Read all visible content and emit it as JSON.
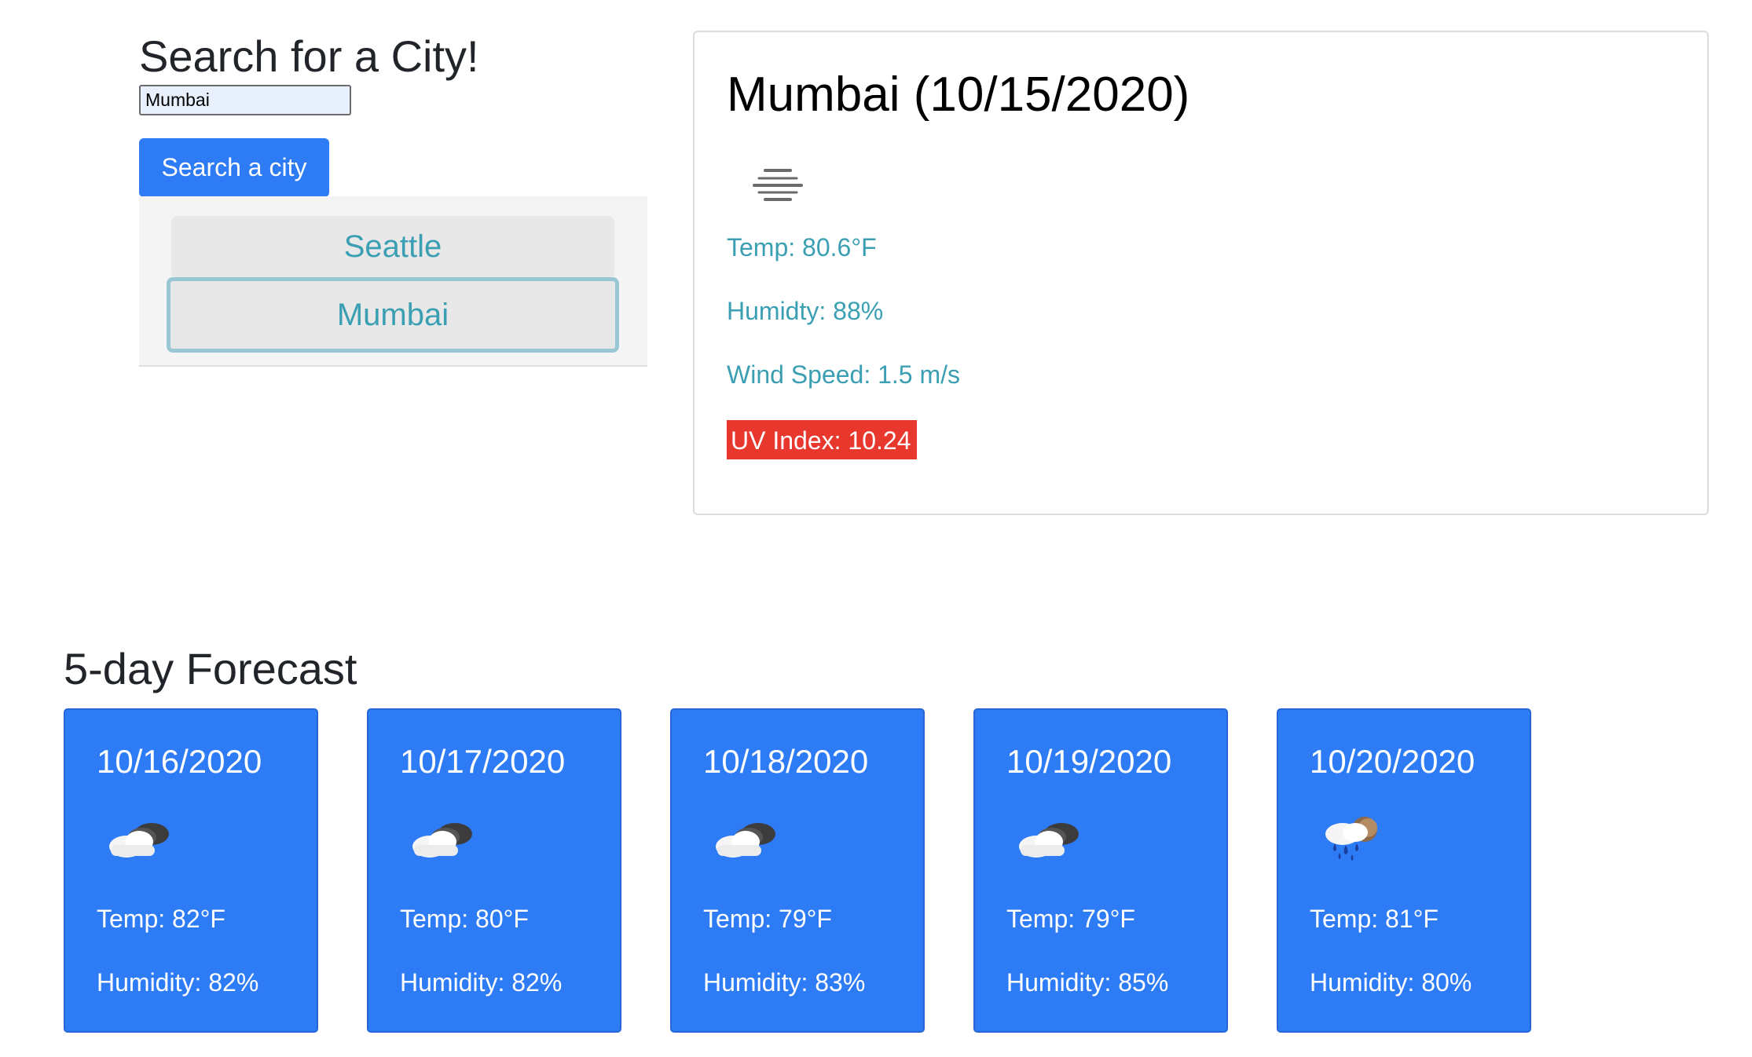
{
  "search": {
    "title": "Search for a City!",
    "input_value": "Mumbai",
    "button_label": "Search a city"
  },
  "history": {
    "items": [
      {
        "label": "Seattle"
      },
      {
        "label": "Mumbai"
      }
    ]
  },
  "current": {
    "title": "Mumbai (10/15/2020)",
    "icon": "fog-icon",
    "temp": "Temp: 80.6°F",
    "humidity": "Humidty: 88%",
    "wind": "Wind Speed: 1.5 m/s",
    "uv": "UV Index: 10.24",
    "uv_color": "#e8372c"
  },
  "forecast": {
    "title": "5-day Forecast",
    "days": [
      {
        "date": "10/16/2020",
        "icon": "partly-cloudy-night-icon",
        "temp": "Temp: 82°F",
        "humidity": "Humidity: 82%"
      },
      {
        "date": "10/17/2020",
        "icon": "partly-cloudy-night-icon",
        "temp": "Temp: 80°F",
        "humidity": "Humidity: 82%"
      },
      {
        "date": "10/18/2020",
        "icon": "partly-cloudy-night-icon",
        "temp": "Temp: 79°F",
        "humidity": "Humidity: 83%"
      },
      {
        "date": "10/19/2020",
        "icon": "partly-cloudy-night-icon",
        "temp": "Temp: 79°F",
        "humidity": "Humidity: 85%"
      },
      {
        "date": "10/20/2020",
        "icon": "rain-night-icon",
        "temp": "Temp: 81°F",
        "humidity": "Humidity: 80%"
      }
    ]
  },
  "colors": {
    "accent": "#2e7bf6",
    "link_text": "#3a9fb3",
    "uv_high": "#e8372c"
  }
}
